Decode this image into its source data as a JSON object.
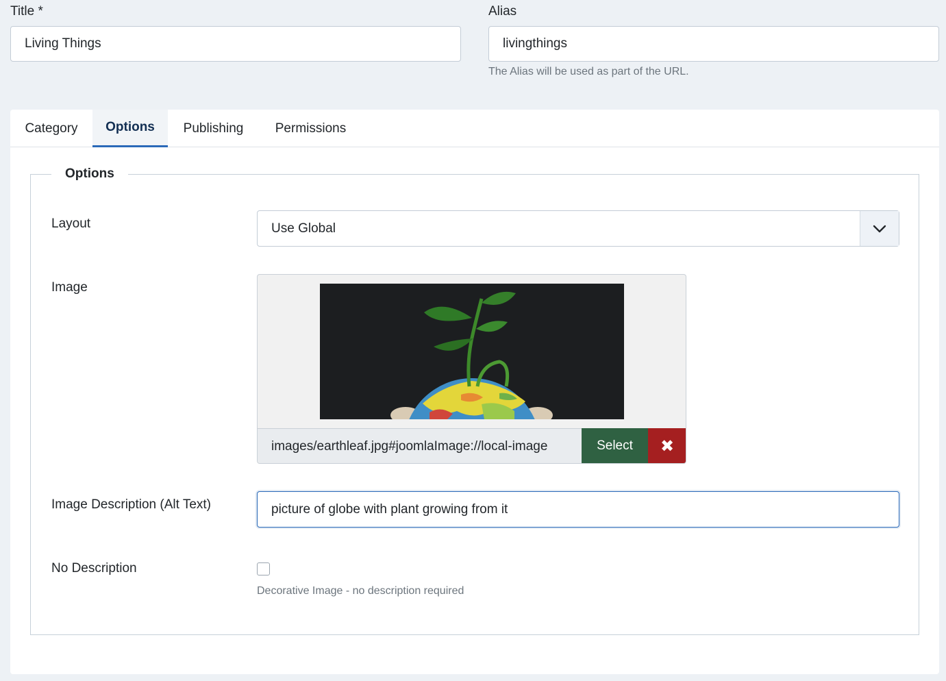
{
  "title_field": {
    "label": "Title *",
    "value": "Living Things"
  },
  "alias_field": {
    "label": "Alias",
    "value": "livingthings",
    "hint": "The Alias will be used as part of the URL."
  },
  "tabs": [
    {
      "label": "Category",
      "active": false
    },
    {
      "label": "Options",
      "active": true
    },
    {
      "label": "Publishing",
      "active": false
    },
    {
      "label": "Permissions",
      "active": false
    }
  ],
  "options": {
    "legend": "Options",
    "layout": {
      "label": "Layout",
      "value": "Use Global",
      "icon": "chevron-down-icon"
    },
    "image": {
      "label": "Image",
      "path": "images/earthleaf.jpg#joomlaImage://local-image",
      "select_label": "Select",
      "clear_icon": "close-icon",
      "clear_glyph": "✖"
    },
    "alt_text": {
      "label": "Image Description (Alt Text)",
      "value": "picture of globe with plant growing from it"
    },
    "no_description": {
      "label": "No Description",
      "checked": false,
      "hint": "Decorative Image - no description required"
    }
  },
  "colors": {
    "page_bg": "#edf1f5",
    "tab_active": "#2a69b8",
    "select_button": "#2f6142",
    "clear_button": "#a51f20"
  }
}
